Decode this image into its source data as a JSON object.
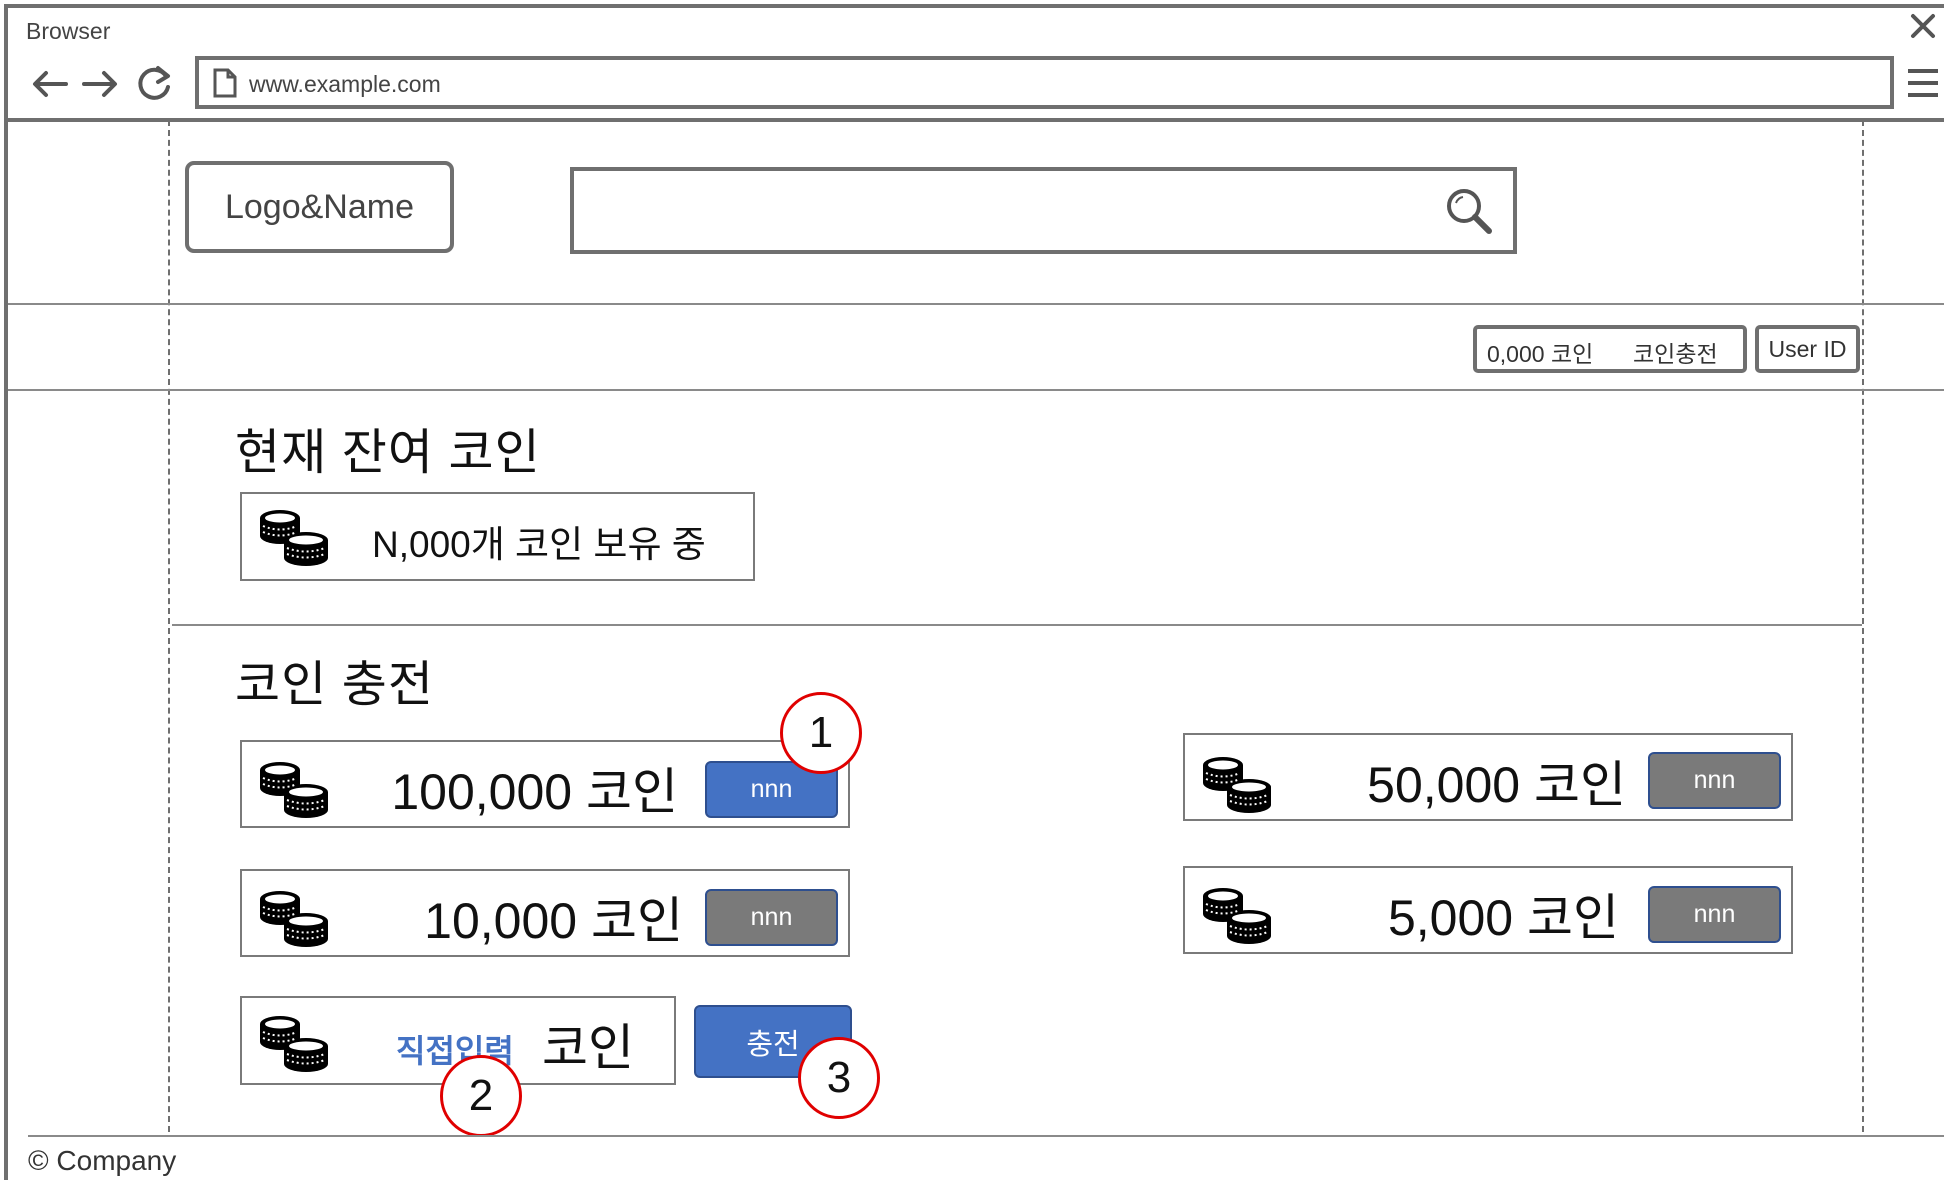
{
  "browser": {
    "title": "Browser",
    "url": "www.example.com"
  },
  "header": {
    "logo_label": "Logo&Name",
    "search_placeholder": ""
  },
  "userbar": {
    "coin_amount": "0,000 코인",
    "charge_link": "코인충전",
    "user_id": "User ID"
  },
  "balance": {
    "title": "현재 잔여 코인",
    "status": "N,000개 코인 보유 중"
  },
  "charge": {
    "title": "코인 충전",
    "options": [
      {
        "amount": "100,000 코인",
        "price": "nnn",
        "state": "selected"
      },
      {
        "amount": "50,000 코인",
        "price": "nnn",
        "state": "default"
      },
      {
        "amount": "10,000 코인",
        "price": "nnn",
        "state": "default"
      },
      {
        "amount": "5,000 코인",
        "price": "nnn",
        "state": "default"
      }
    ],
    "custom": {
      "input_label": "직접입력",
      "unit": "코인",
      "submit_label": "충전"
    }
  },
  "annotations": [
    "1",
    "2",
    "3"
  ],
  "footer": {
    "text": "© Company"
  },
  "colors": {
    "selected_button": "#4472c4",
    "default_button": "#7a7a7a",
    "custom_input_text": "#4472c4",
    "annotation_circle": "#e00000"
  }
}
